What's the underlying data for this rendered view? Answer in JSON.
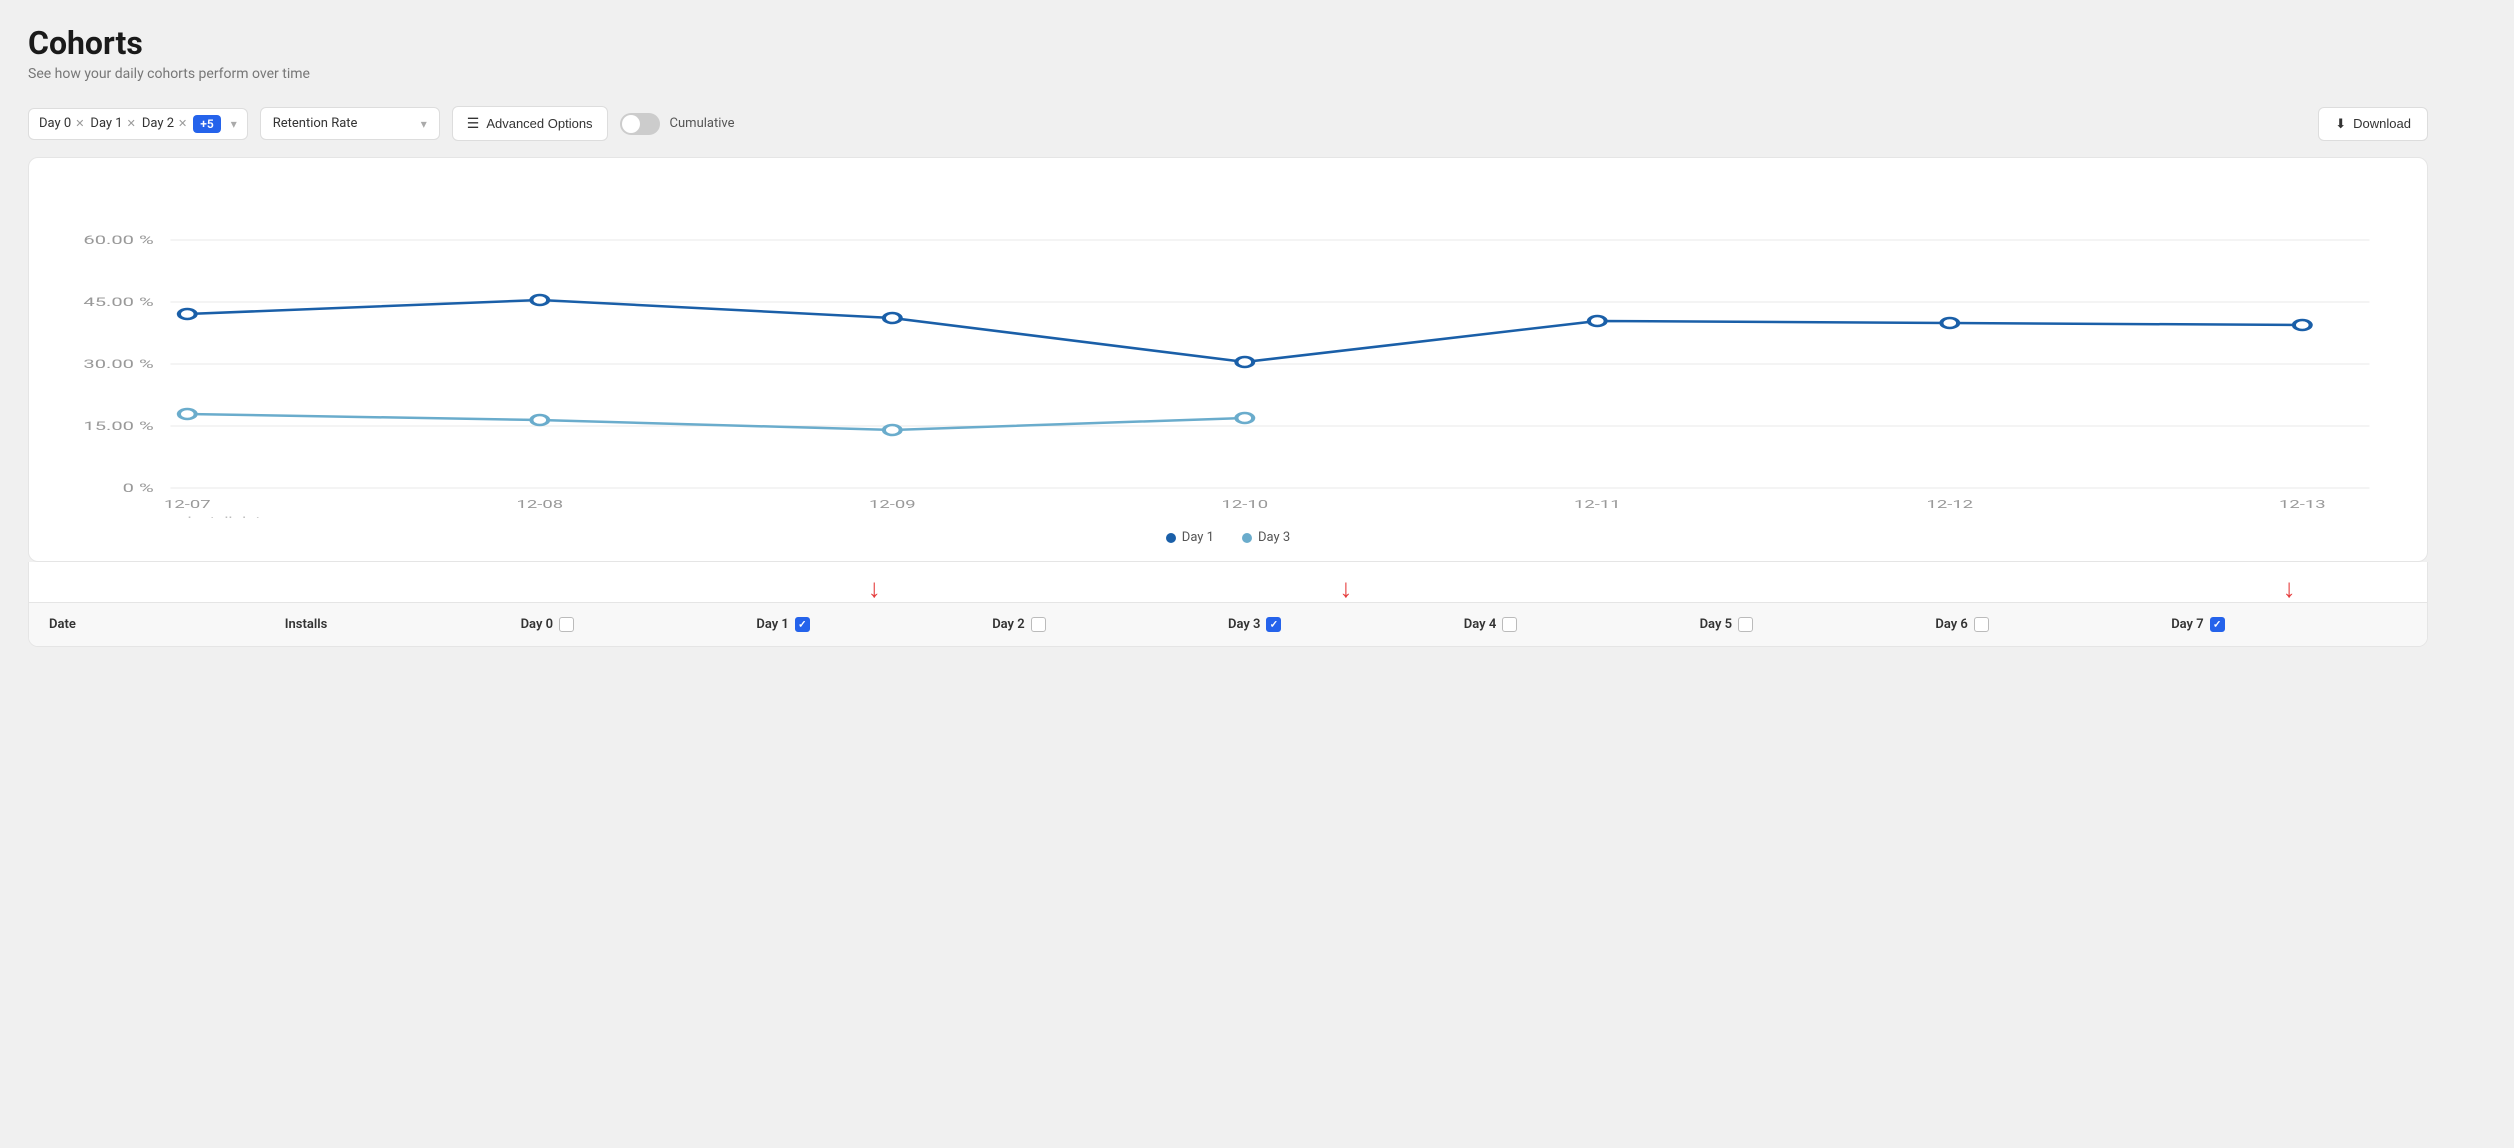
{
  "page": {
    "title": "Cohorts",
    "subtitle": "See how your daily cohorts perform over time"
  },
  "toolbar": {
    "tags": [
      "Day 0",
      "Day 1",
      "Day 2"
    ],
    "more_label": "+5",
    "metric_label": "Retention Rate",
    "advanced_label": "Advanced Options",
    "cumulative_label": "Cumulative",
    "download_label": "Download"
  },
  "chart": {
    "y_labels": [
      "60.00 %",
      "45.00 %",
      "30.00 %",
      "15.00 %",
      "0 %"
    ],
    "x_labels": [
      "12-07",
      "12-08",
      "12-09",
      "12-10",
      "12-11",
      "12-12",
      "12-13"
    ],
    "x_axis_label": "Install date",
    "legend": [
      {
        "label": "Day 1",
        "color": "#1a5fa8"
      },
      {
        "label": "Day 3",
        "color": "#6aaccc"
      }
    ],
    "series": {
      "day1": {
        "color": "#1a5fa8",
        "points": [
          42.0,
          45.5,
          41.0,
          30.5,
          40.5,
          40.0,
          39.5
        ]
      },
      "day3": {
        "color": "#6aaccc",
        "points": [
          18.0,
          16.5,
          14.0,
          17.0,
          null,
          null,
          null
        ]
      }
    }
  },
  "table": {
    "columns": [
      {
        "label": "Date",
        "has_checkbox": false,
        "checked": false
      },
      {
        "label": "Installs",
        "has_checkbox": false,
        "checked": false
      },
      {
        "label": "Day 0",
        "has_checkbox": true,
        "checked": false
      },
      {
        "label": "Day 1",
        "has_checkbox": true,
        "checked": true
      },
      {
        "label": "Day 2",
        "has_checkbox": true,
        "checked": false
      },
      {
        "label": "Day 3",
        "has_checkbox": true,
        "checked": true
      },
      {
        "label": "Day 4",
        "has_checkbox": true,
        "checked": false
      },
      {
        "label": "Day 5",
        "has_checkbox": true,
        "checked": false
      },
      {
        "label": "Day 6",
        "has_checkbox": true,
        "checked": false
      },
      {
        "label": "Day 7",
        "has_checkbox": true,
        "checked": true
      }
    ],
    "arrows_on_cols": [
      3,
      5,
      9
    ]
  }
}
